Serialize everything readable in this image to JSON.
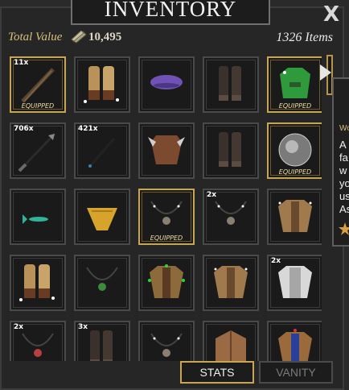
{
  "window": {
    "title": "INVENTORY",
    "close_label": "X"
  },
  "summary": {
    "total_value_label": "Total Value",
    "total_value": "10,495",
    "item_count": "1326 Items"
  },
  "equipped_label": "EQUIPPED",
  "slots": [
    {
      "item": "bow-icon",
      "count": "11x",
      "equipped": true
    },
    {
      "item": "bracers-icon",
      "count": "",
      "equipped": false
    },
    {
      "item": "beret-icon",
      "count": "",
      "equipped": false
    },
    {
      "item": "boots-icon",
      "count": "",
      "equipped": false
    },
    {
      "item": "green-tunic-icon",
      "count": "",
      "equipped": true
    },
    {
      "item": "arrow-icon",
      "count": "706x",
      "equipped": false
    },
    {
      "item": "dart-icon",
      "count": "421x",
      "equipped": false
    },
    {
      "item": "horned-armor-icon",
      "count": "",
      "equipped": false
    },
    {
      "item": "boots-icon",
      "count": "",
      "equipped": false
    },
    {
      "item": "orb-icon",
      "count": "",
      "equipped": true
    },
    {
      "item": "teal-fish-icon",
      "count": "",
      "equipped": false
    },
    {
      "item": "yellow-cloth-icon",
      "count": "",
      "equipped": false
    },
    {
      "item": "amulet-icon",
      "count": "",
      "equipped": true
    },
    {
      "item": "amulet-icon",
      "count": "2x",
      "equipped": false
    },
    {
      "item": "tan-armor-icon",
      "count": "",
      "equipped": false
    },
    {
      "item": "bracers-icon",
      "count": "",
      "equipped": false
    },
    {
      "item": "green-amulet-icon",
      "count": "",
      "equipped": false
    },
    {
      "item": "green-armor-icon",
      "count": "",
      "equipped": false
    },
    {
      "item": "tan-armor-icon",
      "count": "",
      "equipped": false
    },
    {
      "item": "white-armor-icon",
      "count": "2x",
      "equipped": false
    },
    {
      "item": "red-amulet-icon",
      "count": "2x",
      "equipped": false
    },
    {
      "item": "boots-icon",
      "count": "3x",
      "equipped": false
    },
    {
      "item": "amulet-icon",
      "count": "",
      "equipped": false
    },
    {
      "item": "crate-icon",
      "count": "",
      "equipped": false
    },
    {
      "item": "blue-armor-icon",
      "count": "",
      "equipped": false
    }
  ],
  "tooltip": {
    "title": "Wo",
    "lines": [
      "A",
      "fa",
      "w",
      "yo",
      "us",
      "As"
    ]
  },
  "tabs": {
    "stats": "STATS",
    "vanity": "VANITY"
  }
}
